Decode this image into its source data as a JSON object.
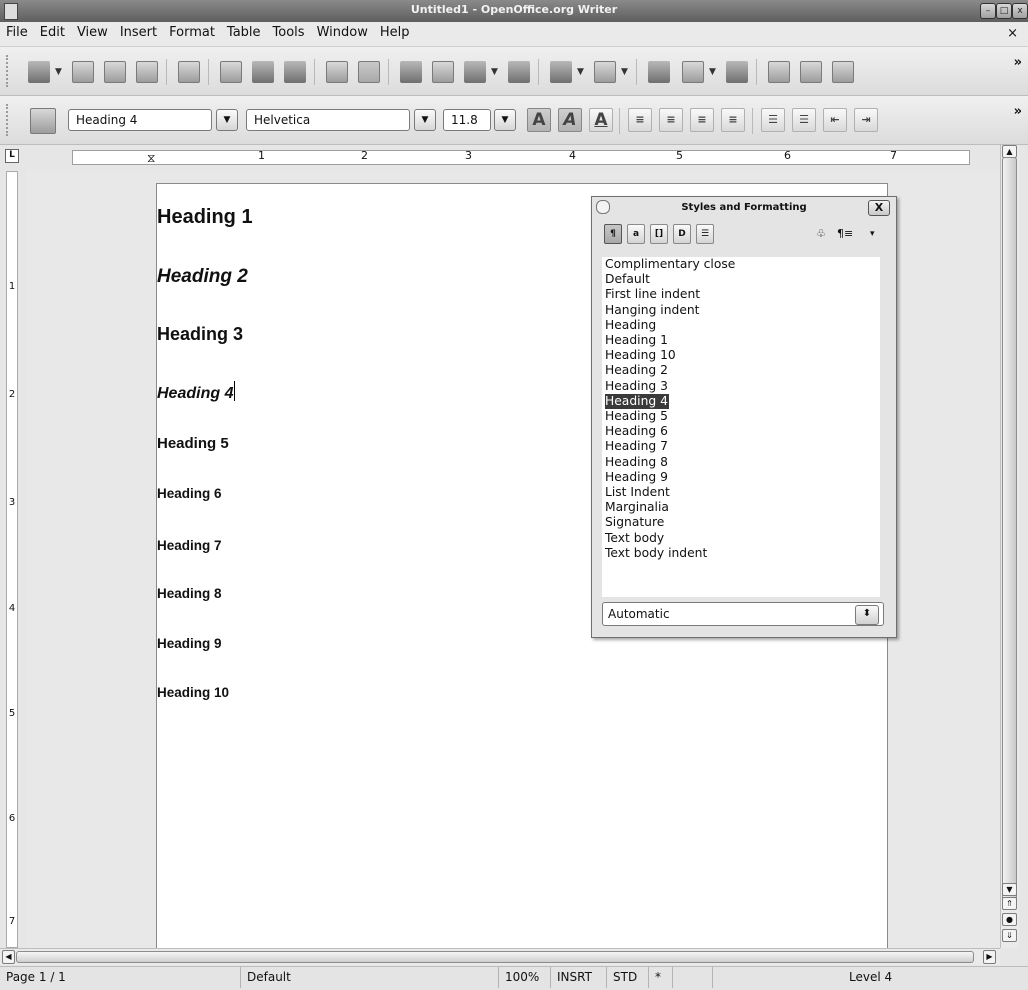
{
  "window": {
    "title": "Untitled1 - OpenOffice.org Writer",
    "doc_close": "×"
  },
  "menu": [
    "File",
    "Edit",
    "View",
    "Insert",
    "Format",
    "Table",
    "Tools",
    "Window",
    "Help"
  ],
  "format_toolbar": {
    "paragraph_style": "Heading 4",
    "font_name": "Helvetica",
    "font_size": "11.8"
  },
  "ruler": {
    "h_numbers": [
      "1",
      "2",
      "3",
      "4",
      "5",
      "6",
      "7"
    ],
    "v_numbers": [
      "1",
      "2",
      "3",
      "4",
      "5",
      "6",
      "7"
    ]
  },
  "document": {
    "headings": [
      "Heading 1",
      "Heading 2",
      "Heading 3",
      "Heading 4",
      "Heading 5",
      "Heading 6",
      "Heading 7",
      "Heading 8",
      "Heading 9",
      "Heading 10"
    ]
  },
  "styles_panel": {
    "title": "Styles and Formatting",
    "close_label": "X",
    "styles": [
      "Complimentary close",
      "Default",
      "First line indent",
      "Hanging indent",
      "Heading",
      "Heading 1",
      "Heading 10",
      "Heading 2",
      "Heading 3",
      "Heading 4",
      "Heading 5",
      "Heading 6",
      "Heading 7",
      "Heading 8",
      "Heading 9",
      "List Indent",
      "Marginalia",
      "Signature",
      "Text body",
      "Text body indent"
    ],
    "selected_style": "Heading 4",
    "filter": "Automatic"
  },
  "status": {
    "page": "Page 1 / 1",
    "page_style": "Default",
    "zoom": "100%",
    "insert_mode": "INSRT",
    "selection_mode": "STD",
    "modified": "*",
    "outline_level": "Level 4"
  }
}
